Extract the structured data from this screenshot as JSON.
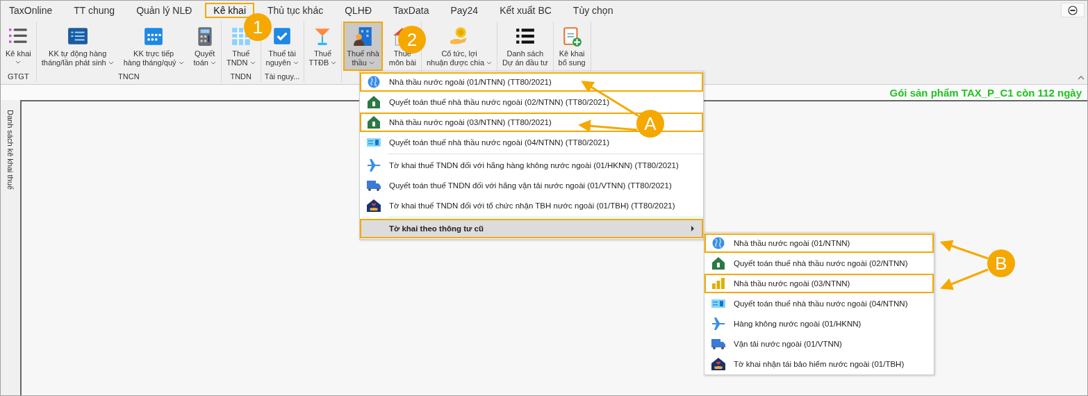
{
  "tabs": [
    {
      "label": "TaxOnline",
      "selected": false,
      "highlighted": false
    },
    {
      "label": "TT chung",
      "selected": false,
      "highlighted": false
    },
    {
      "label": "Quản lý NLĐ",
      "selected": false,
      "highlighted": false
    },
    {
      "label": "Kê khai",
      "selected": true,
      "highlighted": true
    },
    {
      "label": "Thủ tục khác",
      "selected": false,
      "highlighted": false
    },
    {
      "label": "QLHĐ",
      "selected": false,
      "highlighted": false
    },
    {
      "label": "TaxData",
      "selected": false,
      "highlighted": false
    },
    {
      "label": "Pay24",
      "selected": false,
      "highlighted": false
    },
    {
      "label": "Kết xuất BC",
      "selected": false,
      "highlighted": false
    },
    {
      "label": "Tùy chọn",
      "selected": false,
      "highlighted": false
    }
  ],
  "ribbon": {
    "groups": [
      {
        "label": "GTGT",
        "buttons": [
          {
            "lines": [
              "Kê khai"
            ],
            "has_dropdown": true,
            "selected": false,
            "highlighted": false
          }
        ]
      },
      {
        "label": "TNCN",
        "buttons": [
          {
            "lines": [
              "KK tự động hàng",
              "tháng/lần phát sinh"
            ],
            "has_dropdown": true,
            "selected": false,
            "highlighted": false
          },
          {
            "lines": [
              "KK trực tiếp",
              "hàng tháng/quý"
            ],
            "has_dropdown": true,
            "selected": false,
            "highlighted": false
          },
          {
            "lines": [
              "Quyết",
              "toán"
            ],
            "has_dropdown": true,
            "selected": false,
            "highlighted": false
          }
        ]
      },
      {
        "label": "TNDN",
        "buttons": [
          {
            "lines": [
              "Thuế",
              "TNDN"
            ],
            "has_dropdown": true,
            "selected": false,
            "highlighted": false
          }
        ]
      },
      {
        "label": "Tài nguy...",
        "buttons": [
          {
            "lines": [
              "Thuế tài",
              "nguyên"
            ],
            "has_dropdown": true,
            "selected": false,
            "highlighted": false
          }
        ]
      },
      {
        "buttons": [
          {
            "lines": [
              "Thuế",
              "TTĐB"
            ],
            "has_dropdown": true,
            "selected": false,
            "highlighted": false
          }
        ]
      },
      {
        "buttons": [
          {
            "lines": [
              "Thuế nhà",
              "thầu"
            ],
            "has_dropdown": true,
            "selected": true,
            "highlighted": true
          },
          {
            "lines": [
              "Thuế",
              "môn bài"
            ],
            "has_dropdown": false,
            "selected": false,
            "highlighted": false
          }
        ]
      },
      {
        "buttons": [
          {
            "lines": [
              "Cổ tức, lợi",
              "nhuận được chia"
            ],
            "has_dropdown": true,
            "selected": false,
            "highlighted": false
          }
        ]
      },
      {
        "buttons": [
          {
            "lines": [
              "Danh sách",
              "Dự án đầu tư"
            ],
            "has_dropdown": false,
            "selected": false,
            "highlighted": false
          }
        ]
      },
      {
        "buttons": [
          {
            "lines": [
              "Kê khai",
              "bổ sung"
            ],
            "has_dropdown": false,
            "selected": false,
            "highlighted": false
          }
        ]
      }
    ]
  },
  "status": {
    "text": "Gói sản phẩm TAX_P_C1 còn 112 ngày"
  },
  "sidebar": {
    "title": "Danh sách kê khai thuế"
  },
  "menu": {
    "items": [
      {
        "kind": "item",
        "label": "Nhà thầu nước ngoài (01/NTNN) (TT80/2021)",
        "highlighted": true
      },
      {
        "kind": "item",
        "label": "Quyết toán thuế nhà thầu nước ngoài (02/NTNN) (TT80/2021)",
        "highlighted": false
      },
      {
        "kind": "item",
        "label": "Nhà thầu nước ngoài (03/NTNN) (TT80/2021)",
        "highlighted": true
      },
      {
        "kind": "item",
        "label": "Quyết toán thuế nhà thầu nước ngoài (04/NTNN) (TT80/2021)",
        "highlighted": false
      },
      {
        "kind": "separator"
      },
      {
        "kind": "item",
        "label": "Tờ khai thuế TNDN đối với hãng hàng không nước ngoài (01/HKNN) (TT80/2021)",
        "highlighted": false
      },
      {
        "kind": "item",
        "label": "Quyết toán thuế TNDN đối với hãng vận tải nước ngoài (01/VTNN) (TT80/2021)",
        "highlighted": false
      },
      {
        "kind": "item",
        "label": "Tờ khai thuế TNDN đối với tổ chức nhận TBH nước ngoài (01/TBH) (TT80/2021)",
        "highlighted": false
      },
      {
        "kind": "separator"
      },
      {
        "kind": "submenu",
        "label": "Tờ khai theo thông tư cũ",
        "selected": true,
        "highlighted": true,
        "items": [
          {
            "label": "Nhà thầu nước ngoài (01/NTNN)",
            "highlighted": true
          },
          {
            "label": "Quyết toán thuế nhà thầu nước ngoài (02/NTNN)",
            "highlighted": false
          },
          {
            "label": "Nhà thầu nước ngoài (03/NTNN)",
            "highlighted": true
          },
          {
            "label": "Quyết toán thuế nhà thầu nước ngoài (04/NTNN)",
            "highlighted": false
          },
          {
            "label": "Hàng không nước ngoài (01/HKNN)",
            "highlighted": false
          },
          {
            "label": "Vận tải nước ngoài (01/VTNN)",
            "highlighted": false
          },
          {
            "label": "Tờ khai nhận tái bảo hiểm nước ngoài (01/TBH)",
            "highlighted": false
          }
        ]
      }
    ]
  },
  "callouts": [
    {
      "label": "1"
    },
    {
      "label": "2"
    },
    {
      "label": "A"
    },
    {
      "label": "B"
    }
  ]
}
